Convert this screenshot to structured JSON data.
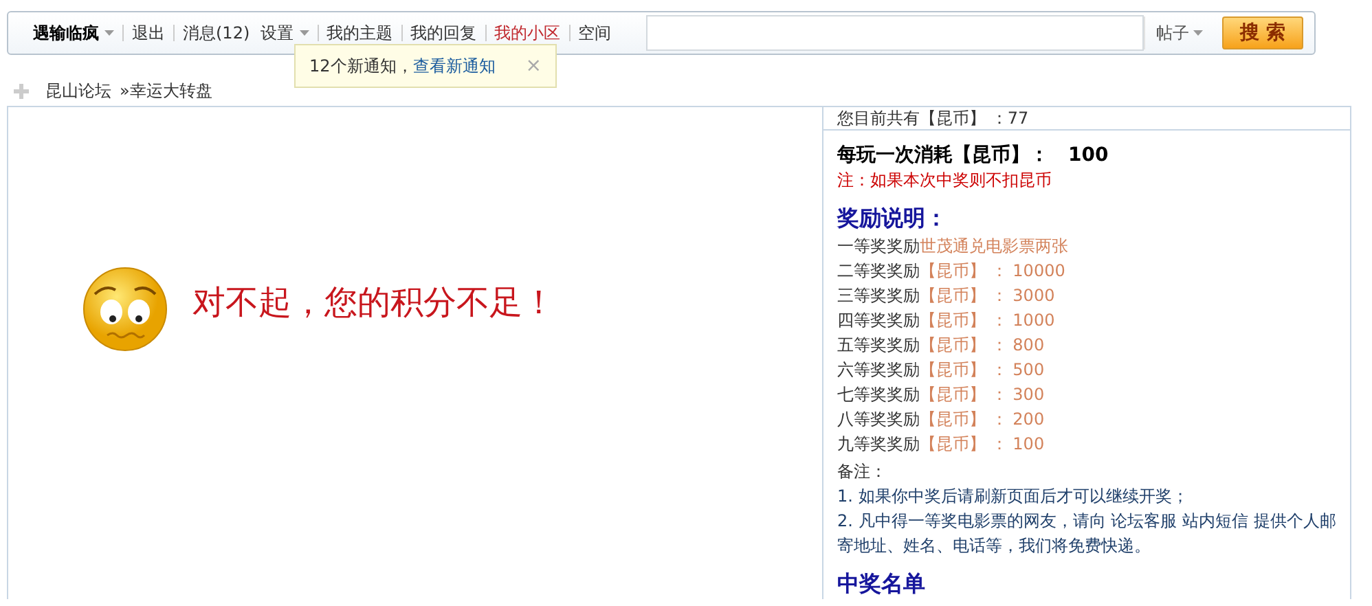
{
  "nav": {
    "items": [
      {
        "label": "遇输临疯",
        "kind": "user",
        "selected": false
      },
      {
        "label": "退出",
        "kind": "link",
        "selected": false
      },
      {
        "label": "消息(12)",
        "kind": "link",
        "selected": false
      },
      {
        "label": "设置",
        "kind": "menu",
        "selected": false
      },
      {
        "label": "我的主题",
        "kind": "link",
        "selected": false
      },
      {
        "label": "我的回复",
        "kind": "link",
        "selected": false
      },
      {
        "label": "我的小区",
        "kind": "link",
        "selected": true
      },
      {
        "label": "空间",
        "kind": "link",
        "selected": false
      }
    ]
  },
  "search": {
    "scope": "帖子",
    "button": "搜 索"
  },
  "notification": {
    "text": "12个新通知，",
    "link": "查看新通知",
    "close": "×"
  },
  "breadcrumb": [
    "昆山论坛",
    "»幸运大转盘"
  ],
  "message": "对不起，您的积分不足！",
  "sidebar": {
    "balance": "您目前共有【昆币】 ：77",
    "cost_label": "每玩一次消耗【昆币】：",
    "cost": "100",
    "note": "注：如果本次中奖则不扣昆币",
    "rewards_title": "奖励说明：",
    "rewards": [
      {
        "tier": "一等奖奖励",
        "prize": "世茂通兑电影票两张"
      },
      {
        "tier": "二等奖奖励",
        "prize": "【昆币】 ： 10000"
      },
      {
        "tier": "三等奖奖励",
        "prize": "【昆币】 ： 3000"
      },
      {
        "tier": "四等奖奖励",
        "prize": "【昆币】 ： 1000"
      },
      {
        "tier": "五等奖奖励",
        "prize": "【昆币】 ： 800"
      },
      {
        "tier": "六等奖奖励",
        "prize": "【昆币】 ： 500"
      },
      {
        "tier": "七等奖奖励",
        "prize": "【昆币】 ： 300"
      },
      {
        "tier": "八等奖奖励",
        "prize": "【昆币】 ： 200"
      },
      {
        "tier": "九等奖奖励",
        "prize": "【昆币】 ： 100"
      }
    ],
    "remarks_title": "备注：",
    "remarks": [
      "1. 如果你中奖后请刷新页面后才可以继续开奖；",
      "2. 凡中得一等奖电影票的网友，请向 论坛客服 站内短信 提供个人邮寄地址、姓名、电话等，我们将免费快递。"
    ],
    "winners_title": "中奖名单"
  }
}
